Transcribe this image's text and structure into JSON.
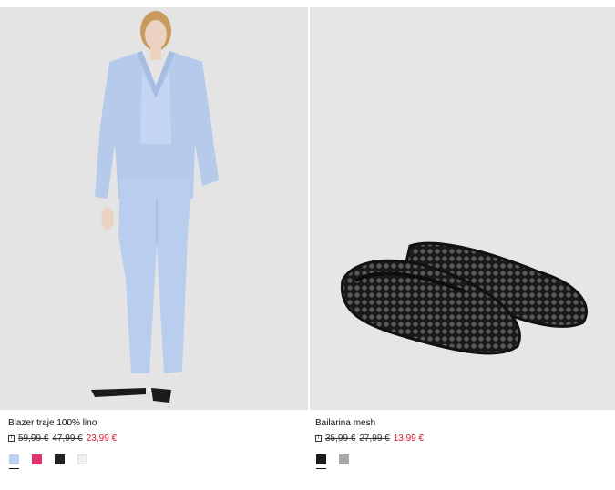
{
  "products": [
    {
      "name": "Blazer traje 100% lino",
      "prices": [
        "59,99 €",
        "47,99 €",
        "23,99 €"
      ],
      "colors": [
        "#bcd0ef",
        "#e0336a",
        "#222222",
        "#f1f0ea"
      ],
      "selected_color": 0,
      "image_icon": "product-photo-blazer"
    },
    {
      "name": "Bailarina mesh",
      "prices": [
        "35,99 €",
        "27,99 €",
        "13,99 €"
      ],
      "colors": [
        "#1c1c1c",
        "#a8a8a8"
      ],
      "selected_color": 0,
      "image_icon": "product-photo-flats"
    }
  ],
  "info_icon_glyph": "i"
}
